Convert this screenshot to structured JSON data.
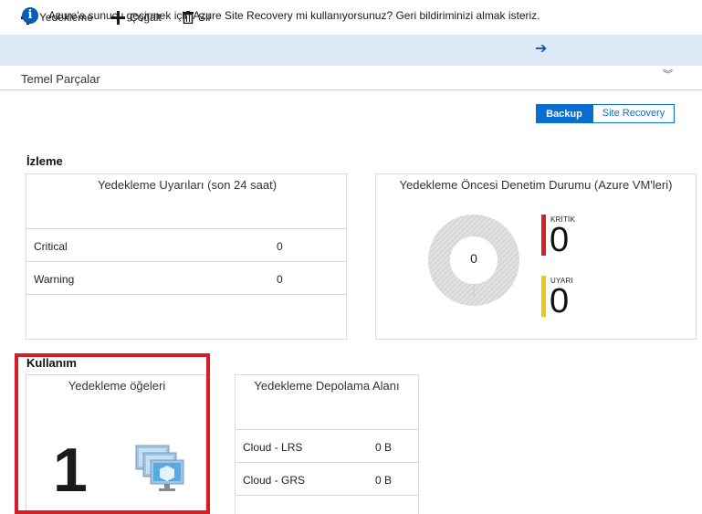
{
  "toolbar": {
    "backup_label": "Yedekleme",
    "replicate_label": "Çoğalt",
    "delete_label": "Sil"
  },
  "infobar": {
    "text": "Azure'a sunucu geçirmek için Azure Site Recovery mi kullanıyorsunuz? Geri bildiriminizi almak isteriz.",
    "arrow": "➔"
  },
  "essentials": {
    "label": "Temel Parçalar",
    "chevron": "︾"
  },
  "toggle": {
    "backup_label": "Backup",
    "site_recovery_label": "Site Recovery"
  },
  "monitoring": {
    "section_title": "İzleme",
    "alerts_tile": {
      "title": "Yedekleme Uyarıları (son 24 saat)",
      "rows": [
        {
          "label": "Critical",
          "value": "0"
        },
        {
          "label": "Warning",
          "value": "0"
        }
      ]
    },
    "precheck_tile": {
      "title": "Yedekleme Öncesi Denetim Durumu (Azure VM'leri)",
      "donut_center": "0",
      "critical_label": "KRİTİK",
      "critical_value": "0",
      "warning_label": "UYARI",
      "warning_value": "0"
    }
  },
  "usage": {
    "section_title": "Kullanım",
    "items_tile": {
      "title": "Yedekleme öğeleri",
      "count": "1"
    },
    "storage_tile": {
      "title": "Yedekleme Depolama Alanı",
      "rows": [
        {
          "label": "Cloud - LRS",
          "value": "0 B"
        },
        {
          "label": "Cloud - GRS",
          "value": "0 B"
        }
      ]
    }
  },
  "colors": {
    "accent": "#0a6ed1",
    "critical": "#d71e28",
    "warning": "#f0c419",
    "highlight": "#d71e28"
  }
}
